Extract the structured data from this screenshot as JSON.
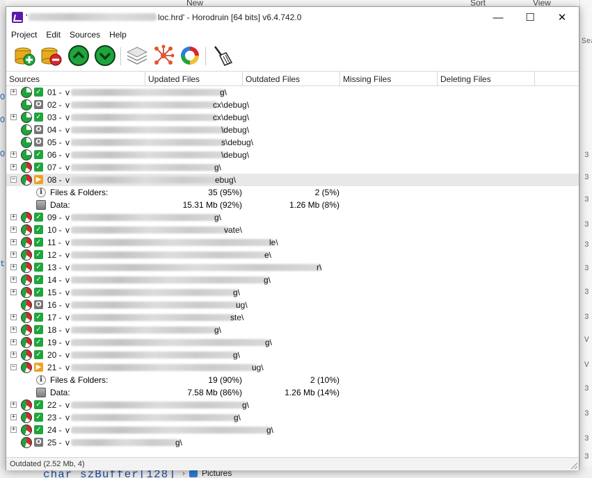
{
  "background": {
    "top_buttons": [
      "New",
      "Sort",
      "View"
    ],
    "code_text": "char szBuffer[128]",
    "pictures_label": "Pictures",
    "right_margin_text": "Sear",
    "right_margin_marks": [
      "3",
      "3",
      "3",
      "3",
      "3",
      "3",
      "3",
      "3",
      "V",
      "V",
      "3",
      "3",
      "3",
      "3",
      "3",
      "3",
      "3",
      "3"
    ],
    "left_margin_marks": [
      "O",
      "O",
      "O",
      "t"
    ]
  },
  "window": {
    "title_prefix": "'",
    "title_suffix": "loc.hrd' - Horodruin [64 bits] v6.4.742.0",
    "controls": {
      "minimize": "—",
      "maximize": "☐",
      "close": "✕"
    },
    "menu": [
      "Project",
      "Edit",
      "Sources",
      "Help"
    ],
    "toolbar": [
      {
        "icon": "add-source-icon"
      },
      {
        "icon": "remove-source-icon"
      },
      {
        "icon": "move-up-icon"
      },
      {
        "icon": "move-down-icon"
      },
      {
        "icon": "layers-icon"
      },
      {
        "icon": "network-icon"
      },
      {
        "icon": "sync-cycle-icon"
      },
      {
        "icon": "cleanup-broom-icon"
      }
    ],
    "columns": [
      "Sources",
      "Updated Files",
      "Outdated Files",
      "Missing Files",
      "Deleting Files"
    ],
    "status": "Outdated (2.52 Mb, 4)"
  },
  "rows": [
    {
      "num": "01 -",
      "prefix": "v",
      "suffix": "g\\",
      "exp": "+",
      "status": "ok",
      "pie": "green"
    },
    {
      "num": "02 -",
      "prefix": "v",
      "suffix": "cx\\debug\\",
      "exp": "",
      "status": "dis",
      "pie": "green"
    },
    {
      "num": "03 -",
      "prefix": "v",
      "suffix": "cx\\debug\\",
      "exp": "+",
      "status": "ok",
      "pie": "green"
    },
    {
      "num": "04 -",
      "prefix": "v",
      "suffix": "\\debug\\",
      "exp": "",
      "status": "dis",
      "pie": "green"
    },
    {
      "num": "05 -",
      "prefix": "v",
      "suffix": "s\\debug\\",
      "exp": "",
      "status": "dis",
      "pie": "green"
    },
    {
      "num": "06 -",
      "prefix": "v",
      "suffix": "\\debug\\",
      "exp": "+",
      "status": "ok",
      "pie": "green"
    },
    {
      "num": "07 -",
      "prefix": "v",
      "suffix": "g\\",
      "exp": "+",
      "status": "ok",
      "pie": "red"
    },
    {
      "num": "08 -",
      "prefix": "v",
      "suffix": "ebug\\",
      "exp": "−",
      "status": "out",
      "pie": "red",
      "selected": true
    },
    {
      "detail": "files",
      "label": "Files & Folders:",
      "updated": "35 (95%)",
      "outdated": "2 (5%)"
    },
    {
      "detail": "data",
      "label": "Data:",
      "updated": "15.31 Mb (92%)",
      "outdated": "1.26 Mb (8%)"
    },
    {
      "num": "09 -",
      "prefix": "v",
      "suffix": "g\\",
      "exp": "+",
      "status": "ok",
      "pie": "red"
    },
    {
      "num": "10 -",
      "prefix": "v",
      "suffix": "vate\\",
      "exp": "+",
      "status": "ok",
      "pie": "red"
    },
    {
      "num": "11 -",
      "prefix": "v",
      "suffix": "le\\",
      "exp": "+",
      "status": "ok",
      "pie": "red"
    },
    {
      "num": "12 -",
      "prefix": "v",
      "suffix": "e\\",
      "exp": "+",
      "status": "ok",
      "pie": "red"
    },
    {
      "num": "13 -",
      "prefix": "v",
      "suffix": "r\\",
      "exp": "+",
      "status": "ok",
      "pie": "red"
    },
    {
      "num": "14 -",
      "prefix": "v",
      "suffix": "g\\",
      "exp": "+",
      "status": "ok",
      "pie": "red"
    },
    {
      "num": "15 -",
      "prefix": "v",
      "suffix": "g\\",
      "exp": "+",
      "status": "ok",
      "pie": "red"
    },
    {
      "num": "16 -",
      "prefix": "v",
      "suffix": "ug\\",
      "exp": "",
      "status": "dis",
      "pie": "red"
    },
    {
      "num": "17 -",
      "prefix": "v",
      "suffix": "ste\\",
      "exp": "+",
      "status": "ok",
      "pie": "red"
    },
    {
      "num": "18 -",
      "prefix": "v",
      "suffix": "g\\",
      "exp": "+",
      "status": "ok",
      "pie": "red"
    },
    {
      "num": "19 -",
      "prefix": "v",
      "suffix": "g\\",
      "exp": "+",
      "status": "ok",
      "pie": "red"
    },
    {
      "num": "20 -",
      "prefix": "v",
      "suffix": "g\\",
      "exp": "+",
      "status": "ok",
      "pie": "red"
    },
    {
      "num": "21 -",
      "prefix": "v",
      "suffix": "ug\\",
      "exp": "−",
      "status": "out",
      "pie": "red"
    },
    {
      "detail": "files",
      "label": "Files & Folders:",
      "updated": "19 (90%)",
      "outdated": "2 (10%)"
    },
    {
      "detail": "data",
      "label": "Data:",
      "updated": "7.58 Mb (86%)",
      "outdated": "1.26 Mb (14%)"
    },
    {
      "num": "22 -",
      "prefix": "v",
      "suffix": "g\\",
      "exp": "+",
      "status": "ok",
      "pie": "red"
    },
    {
      "num": "23 -",
      "prefix": "v",
      "suffix": "g\\",
      "exp": "+",
      "status": "ok",
      "pie": "red"
    },
    {
      "num": "24 -",
      "prefix": "v",
      "suffix": "g\\",
      "exp": "+",
      "status": "ok",
      "pie": "red"
    },
    {
      "num": "25 -",
      "prefix": "v",
      "suffix": "g\\",
      "exp": "",
      "status": "dis",
      "pie": "red"
    }
  ]
}
